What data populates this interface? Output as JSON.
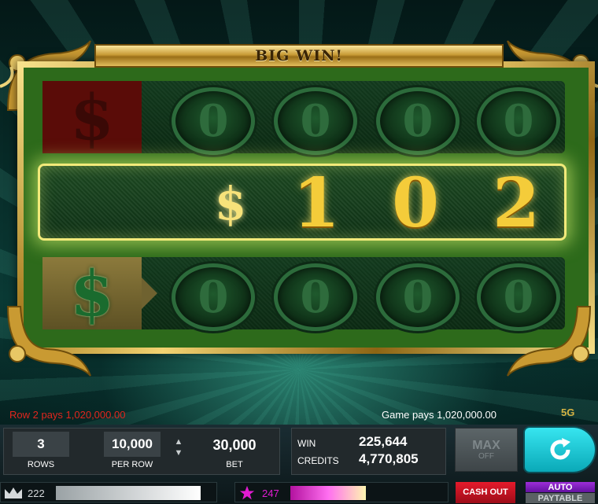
{
  "title": "BIG WIN!",
  "rows": {
    "row1": {
      "symbol": "$",
      "digits": [
        "0",
        "0",
        "0",
        "0"
      ]
    },
    "row2": {
      "symbol": "$",
      "digits": [
        "1",
        "0",
        "2"
      ]
    },
    "row3": {
      "symbol": "$",
      "digits": [
        "0",
        "0",
        "0",
        "0"
      ]
    }
  },
  "messages": {
    "row_pays": "Row 2 pays 1,020,000.00",
    "game_pays": "Game pays 1,020,000.00",
    "logo": "5G"
  },
  "bet": {
    "rows_value": "3",
    "rows_label": "ROWS",
    "per_row_value": "10,000",
    "per_row_label": "PER ROW",
    "bet_value": "30,000",
    "bet_label": "BET",
    "up_arrow": "▲",
    "down_arrow": "▼"
  },
  "credits": {
    "win_label": "WIN",
    "win_value": "225,644",
    "credits_label": "CREDITS",
    "credits_value": "4,770,805"
  },
  "buttons": {
    "max_line1": "MAX",
    "max_line2": "OFF",
    "spin_icon": "refresh-icon",
    "cash_out": "CASH OUT",
    "auto": "AUTO",
    "paytable": "PAYTABLE"
  },
  "meters": {
    "crown_value": "222",
    "crown_fill": 0.92,
    "star_value": "247",
    "star_fill": 0.48
  },
  "colors": {
    "row_pays": "#e0261e",
    "gold": "#f4cc3a",
    "spin": "#1fc8d6",
    "cash_out": "#d0142a",
    "auto": "#8a23c7",
    "star": "#e21bd2"
  }
}
